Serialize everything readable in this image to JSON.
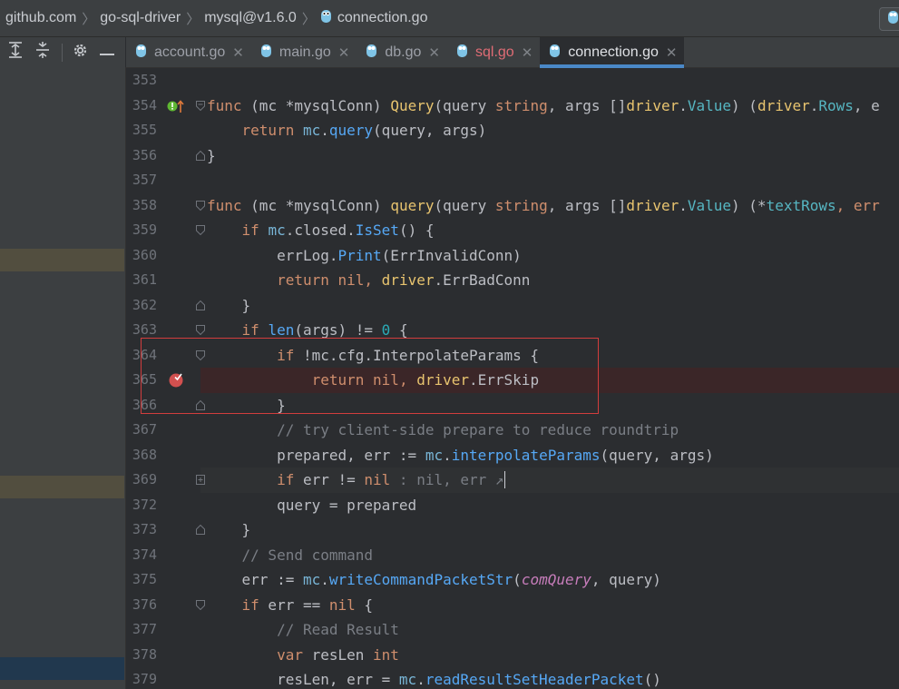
{
  "breadcrumb": {
    "items": [
      "github.com",
      "go-sql-driver",
      "mysql@v1.6.0",
      "connection.go"
    ]
  },
  "tabs": [
    {
      "label": "account.go",
      "active": false
    },
    {
      "label": "main.go",
      "active": false
    },
    {
      "label": "db.go",
      "active": false
    },
    {
      "label": "sql.go",
      "active": false,
      "error": true
    },
    {
      "label": "connection.go",
      "active": true
    }
  ],
  "editor": {
    "lines": [
      {
        "n": "353"
      },
      {
        "n": "354"
      },
      {
        "n": "355"
      },
      {
        "n": "356"
      },
      {
        "n": "357"
      },
      {
        "n": "358"
      },
      {
        "n": "359"
      },
      {
        "n": "360"
      },
      {
        "n": "361"
      },
      {
        "n": "362"
      },
      {
        "n": "363"
      },
      {
        "n": "364"
      },
      {
        "n": "365"
      },
      {
        "n": "366"
      },
      {
        "n": "367"
      },
      {
        "n": "368"
      },
      {
        "n": "369"
      },
      {
        "n": "372"
      },
      {
        "n": "373"
      },
      {
        "n": "374"
      },
      {
        "n": "375"
      },
      {
        "n": "376"
      },
      {
        "n": "377"
      },
      {
        "n": "378"
      },
      {
        "n": "379"
      }
    ],
    "code": {
      "l354": {
        "func": "func",
        "recv": "(mc *",
        "recvType": "mysqlConn",
        "close": ") ",
        "name": "Query",
        "args1": "(query ",
        "t1": "string",
        "args2": ", args []",
        "pkg": "driver",
        "dot": ".",
        "t2": "Value",
        "args3": ") (",
        "pkg2": "driver",
        "dot2": ".",
        "t3": "Rows",
        "tail": ", e"
      },
      "l355": {
        "kw": "return",
        "obj": "mc",
        "dot": ".",
        "call": "query",
        "rest": "(query, args)"
      },
      "l356": {
        "text": "}"
      },
      "l358": {
        "func": "func",
        "recv": "(mc *",
        "recvType": "mysqlConn",
        "close": ") ",
        "name": "query",
        "args1": "(query ",
        "t1": "string",
        "args2": ", args []",
        "pkg": "driver",
        "dot": ".",
        "t2": "Value",
        "args3": ") (*",
        "t3": "textRows",
        "tail": ", err"
      },
      "l359": {
        "kw": "if",
        "obj": "mc",
        "rest": ".closed.",
        "call": "IsSet",
        "tail": "() {"
      },
      "l360": {
        "obj": "errLog",
        "dot": ".",
        "call": "Print",
        "rest": "(ErrInvalidConn)"
      },
      "l361": {
        "kw": "return",
        "nil": "nil",
        "comma": ", ",
        "pkg": "driver",
        "dot": ".",
        "err": "ErrBadConn"
      },
      "l362": {
        "text": "}"
      },
      "l363": {
        "kw": "if",
        "call": "len",
        "rest": "(args) != ",
        "num": "0",
        "tail": " {"
      },
      "l364": {
        "kw": "if",
        "rest": " !mc.cfg.InterpolateParams {"
      },
      "l365": {
        "kw": "return",
        "nil": "nil",
        "comma": ", ",
        "pkg": "driver",
        "dot": ".",
        "err": "ErrSkip"
      },
      "l366": {
        "text": "}"
      },
      "l367": {
        "comment": "// try client-side prepare to reduce roundtrip"
      },
      "l368": {
        "lhs": "prepared, err := ",
        "obj": "mc",
        "dot": ".",
        "call": "interpolateParams",
        "rest": "(query, args)"
      },
      "l369": {
        "kw": "if",
        "rest": " err != ",
        "nil": "nil",
        "fold": " : nil, err ",
        "arrow": "↗"
      },
      "l372": {
        "text": "query = prepared"
      },
      "l373": {
        "text": "}"
      },
      "l374": {
        "comment": "// Send command"
      },
      "l375": {
        "lhs": "err := ",
        "obj": "mc",
        "dot": ".",
        "call": "writeCommandPacketStr",
        "open": "(",
        "param": "comQuery",
        "rest": ", query)"
      },
      "l376": {
        "kw": "if",
        "rest": " err == ",
        "nil": "nil",
        "tail": " {"
      },
      "l377": {
        "comment": "// Read Result"
      },
      "l378": {
        "kw": "var",
        "rest": " resLen ",
        "ty": "int"
      },
      "l379": {
        "lhs": "resLen, err = ",
        "obj": "mc",
        "dot": ".",
        "call": "readResultSetHeaderPacket",
        "rest": "()"
      }
    }
  }
}
